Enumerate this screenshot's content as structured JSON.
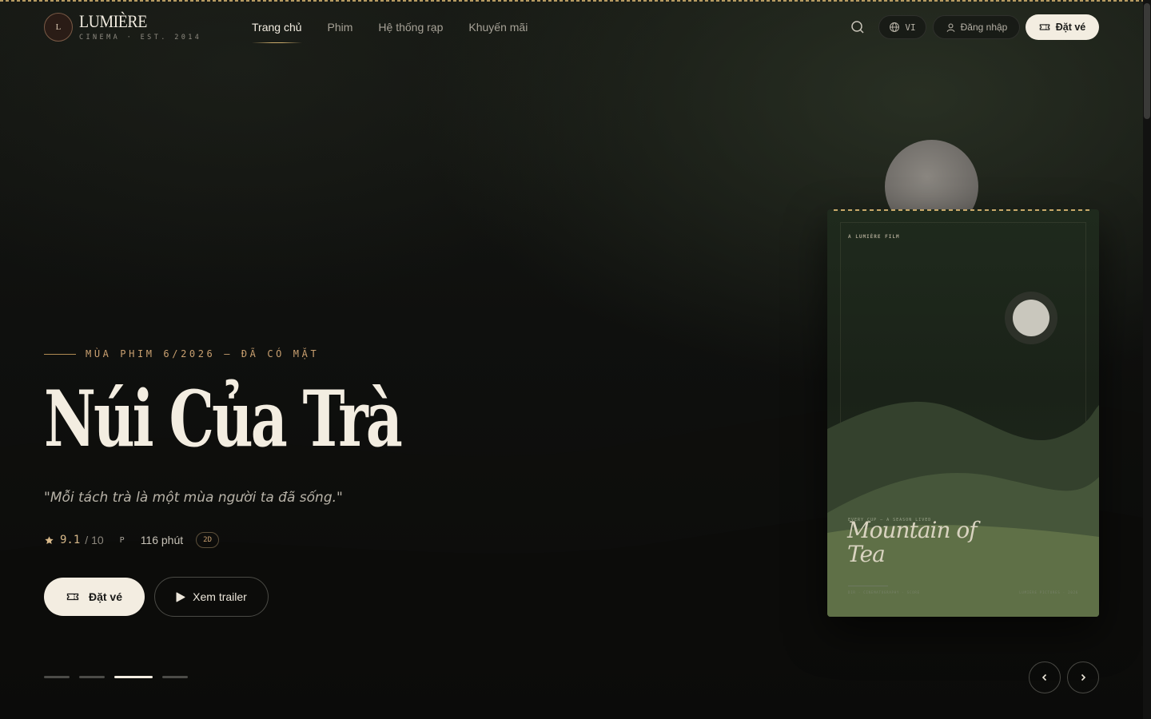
{
  "header": {
    "logo_letter": "L",
    "brand_name": "LUMIÈRE",
    "brand_sub": "CINEMA · EST. 2014",
    "nav": [
      {
        "label": "Trang chủ"
      },
      {
        "label": "Phim"
      },
      {
        "label": "Hệ thống rạp"
      },
      {
        "label": "Khuyến mãi"
      }
    ],
    "language": "VI",
    "login_label": "Đăng nhập",
    "book_label": "Đặt vé"
  },
  "hero": {
    "eyebrow": "MÙA PHIM 6/2026 — ĐÃ CÓ MẶT",
    "title": "Núi Của Trà",
    "tagline": "\"Mỗi tách trà là một mùa người ta đã sống.\"",
    "rating": "9.1",
    "rating_max": "/ 10",
    "age_rating": "P",
    "duration": "116 phút",
    "format": "2D",
    "book_label": "Đặt vé",
    "trailer_label": "Xem trailer"
  },
  "poster": {
    "studio": "A LUMIÈRE FILM",
    "kicker": "EVERY CUP — A SEASON LIVED",
    "title": "Mountain of Tea",
    "credits_left": "DIR · CINEMATOGRAPHY · SCORE",
    "credits_right": "LUMIÈRE PICTURES · 2026"
  },
  "carousel": {
    "slide_count": 4,
    "active_index": 2
  },
  "icons": {
    "search": "search-icon",
    "language": "globe-icon",
    "login": "user-icon",
    "ticket": "ticket-icon",
    "rating": "star-icon",
    "trailer": "play-icon",
    "prev": "chevron-left-icon",
    "next": "chevron-right-icon"
  },
  "colors": {
    "accent_gold": "#c9a96a",
    "cream": "#f3ede1",
    "background": "#0c0c0b",
    "poster_green": "#5f7047"
  }
}
